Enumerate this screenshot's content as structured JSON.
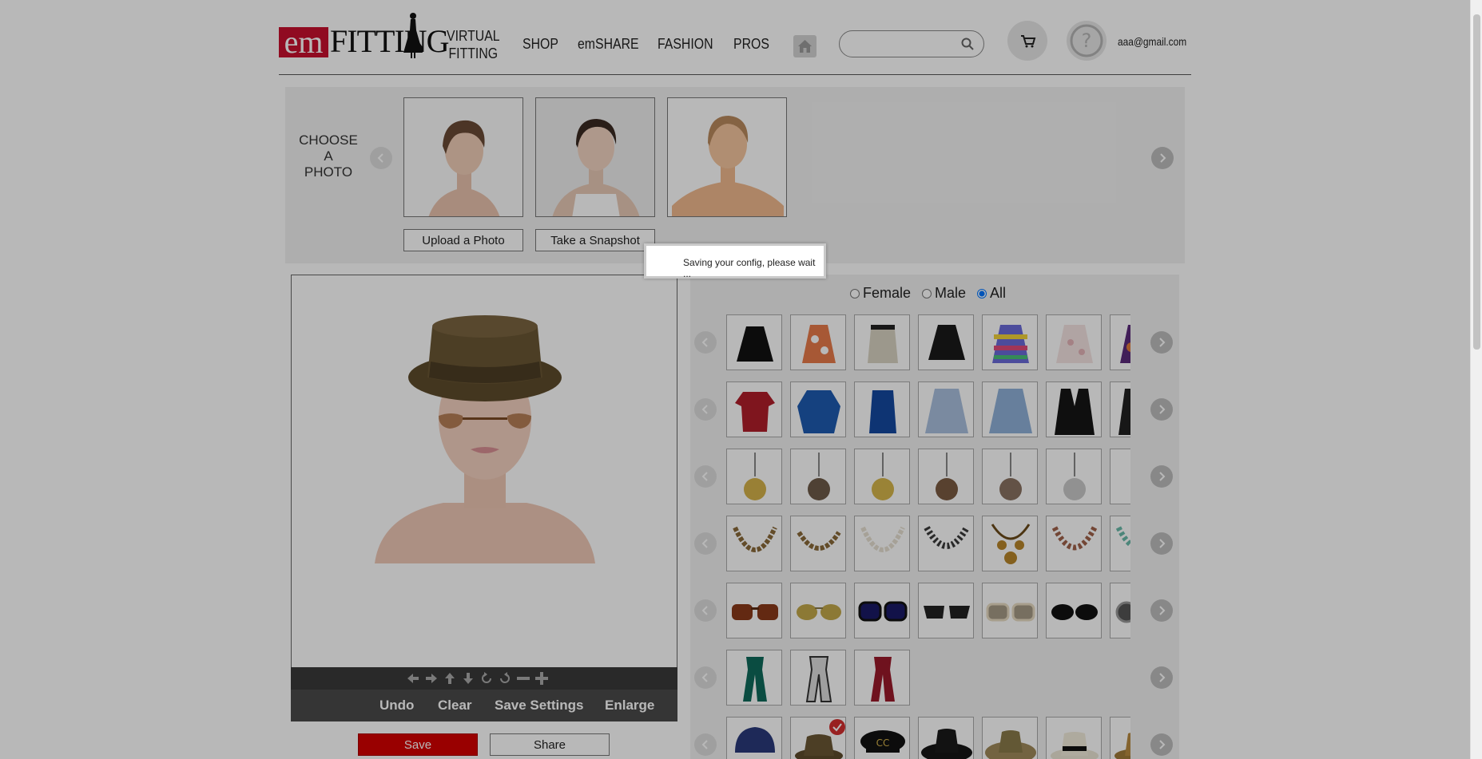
{
  "header": {
    "logo_em": "em",
    "logo_fitting": "FITTING",
    "nav": [
      {
        "label_line1": "VIRTUAL",
        "label_line2": "FITTING"
      },
      {
        "label_line1": "SHOP",
        "label_line2": ""
      },
      {
        "label_line1": "emSHARE",
        "label_line2": ""
      },
      {
        "label_line1": "FASHION",
        "label_line2": ""
      },
      {
        "label_line1": "PROS",
        "label_line2": ""
      }
    ],
    "search_placeholder": "",
    "user_email": "aaa@gmail.com"
  },
  "choose_panel": {
    "label_line1": "CHOOSE",
    "label_line2": "A",
    "label_line3": "PHOTO",
    "upload_label": "Upload a Photo",
    "snapshot_label": "Take a Snapshot"
  },
  "canvas": {
    "undo_label": "Undo",
    "clear_label": "Clear",
    "save_settings_label": "Save Settings",
    "enlarge_label": "Enlarge",
    "save_label": "Save",
    "share_label": "Share"
  },
  "catalog": {
    "gender_options": [
      "Female",
      "Male",
      "All"
    ],
    "gender_selected": "All",
    "rows": [
      {
        "category": "skirts",
        "items": 7
      },
      {
        "category": "tops",
        "items": 7
      },
      {
        "category": "earrings",
        "items": 7
      },
      {
        "category": "necklaces",
        "items": 7
      },
      {
        "category": "sunglasses",
        "items": 7
      },
      {
        "category": "scarves",
        "items": 3
      },
      {
        "category": "hats",
        "items": 7
      }
    ]
  },
  "modal": {
    "message": "Saving your config, please wait ..."
  },
  "colors": {
    "brand_red": "#c8102e",
    "save_red": "#d40000",
    "panel_bg": "#f2f2f2",
    "toolbar_dark": "#3a3a3a"
  }
}
